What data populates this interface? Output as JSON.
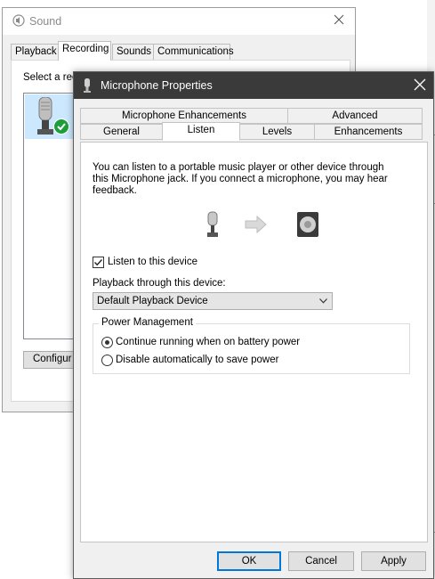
{
  "sound_window": {
    "title": "Sound",
    "tabs": [
      "Playback",
      "Recording",
      "Sounds",
      "Communications"
    ],
    "active_tab": "Recording",
    "instruction": "Select a rec",
    "configure_label": "Configur",
    "icons": {
      "app": "speaker-icon",
      "close": "close-icon",
      "device": "microphone-icon",
      "default_device": "green-check-icon"
    }
  },
  "dialog": {
    "title": "Microphone Properties",
    "tabs_row1": [
      "Microphone Enhancements",
      "Advanced"
    ],
    "tabs_row2": [
      "General",
      "Listen",
      "Levels",
      "Enhancements"
    ],
    "active_tab": "Listen",
    "description": "You can listen to a portable music player or other device through this Microphone jack.  If you connect a microphone, you may hear feedback.",
    "listen_checkbox": {
      "label": "Listen to this device",
      "checked": true
    },
    "playback_label": "Playback through this device:",
    "playback_value": "Default Playback Device",
    "power_group": {
      "legend": "Power Management",
      "options": [
        {
          "label": "Continue running when on battery power",
          "selected": true
        },
        {
          "label": "Disable automatically to save power",
          "selected": false
        }
      ]
    },
    "buttons": {
      "ok": "OK",
      "cancel": "Cancel",
      "apply": "Apply"
    },
    "colors": {
      "titlebar": "#3a3a3a",
      "accent": "#0078d7",
      "check_green": "#1e9e3a"
    }
  }
}
